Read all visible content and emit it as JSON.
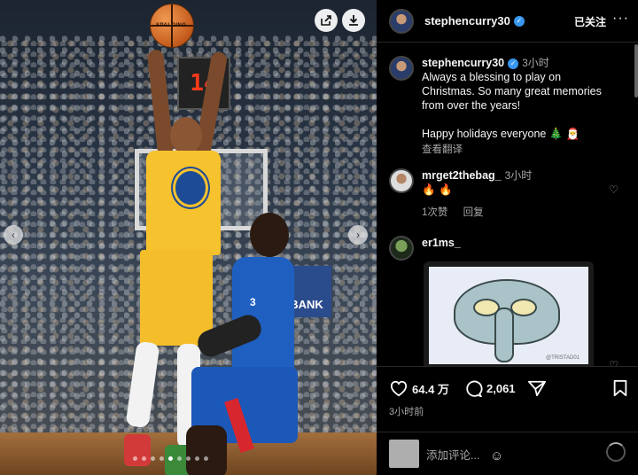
{
  "photo": {
    "shot_clock": "14",
    "ball_brand": "SPALDING",
    "jersey_number_opponent": "3",
    "banner_text": "BANK",
    "carousel": {
      "count": 9,
      "active_index": 4
    }
  },
  "header": {
    "username": "stephencurry30",
    "verified": true,
    "follow_label": "已关注",
    "more_label": "···"
  },
  "caption": {
    "username": "stephencurry30",
    "time": "3小时",
    "text": "Always a blessing to play on Christmas. So many great memories from over the years!",
    "text2": "Happy holidays everyone 🎄 🎅",
    "translate": "查看翻译"
  },
  "comments": [
    {
      "username": "mrget2thebag_",
      "time": "3小时",
      "text": "🔥 🔥",
      "likes": "1次赞",
      "reply": "回复"
    },
    {
      "username": "er1ms_",
      "image_tag": "@TRISTAD01"
    }
  ],
  "actions": {
    "like_count": "64.4 万",
    "comment_count": "2,061",
    "posted": "3小时前"
  },
  "composer": {
    "placeholder": "添加评论..."
  },
  "colors": {
    "accent": "#3897f0",
    "background": "#000000",
    "muted": "#a8a8a8"
  }
}
